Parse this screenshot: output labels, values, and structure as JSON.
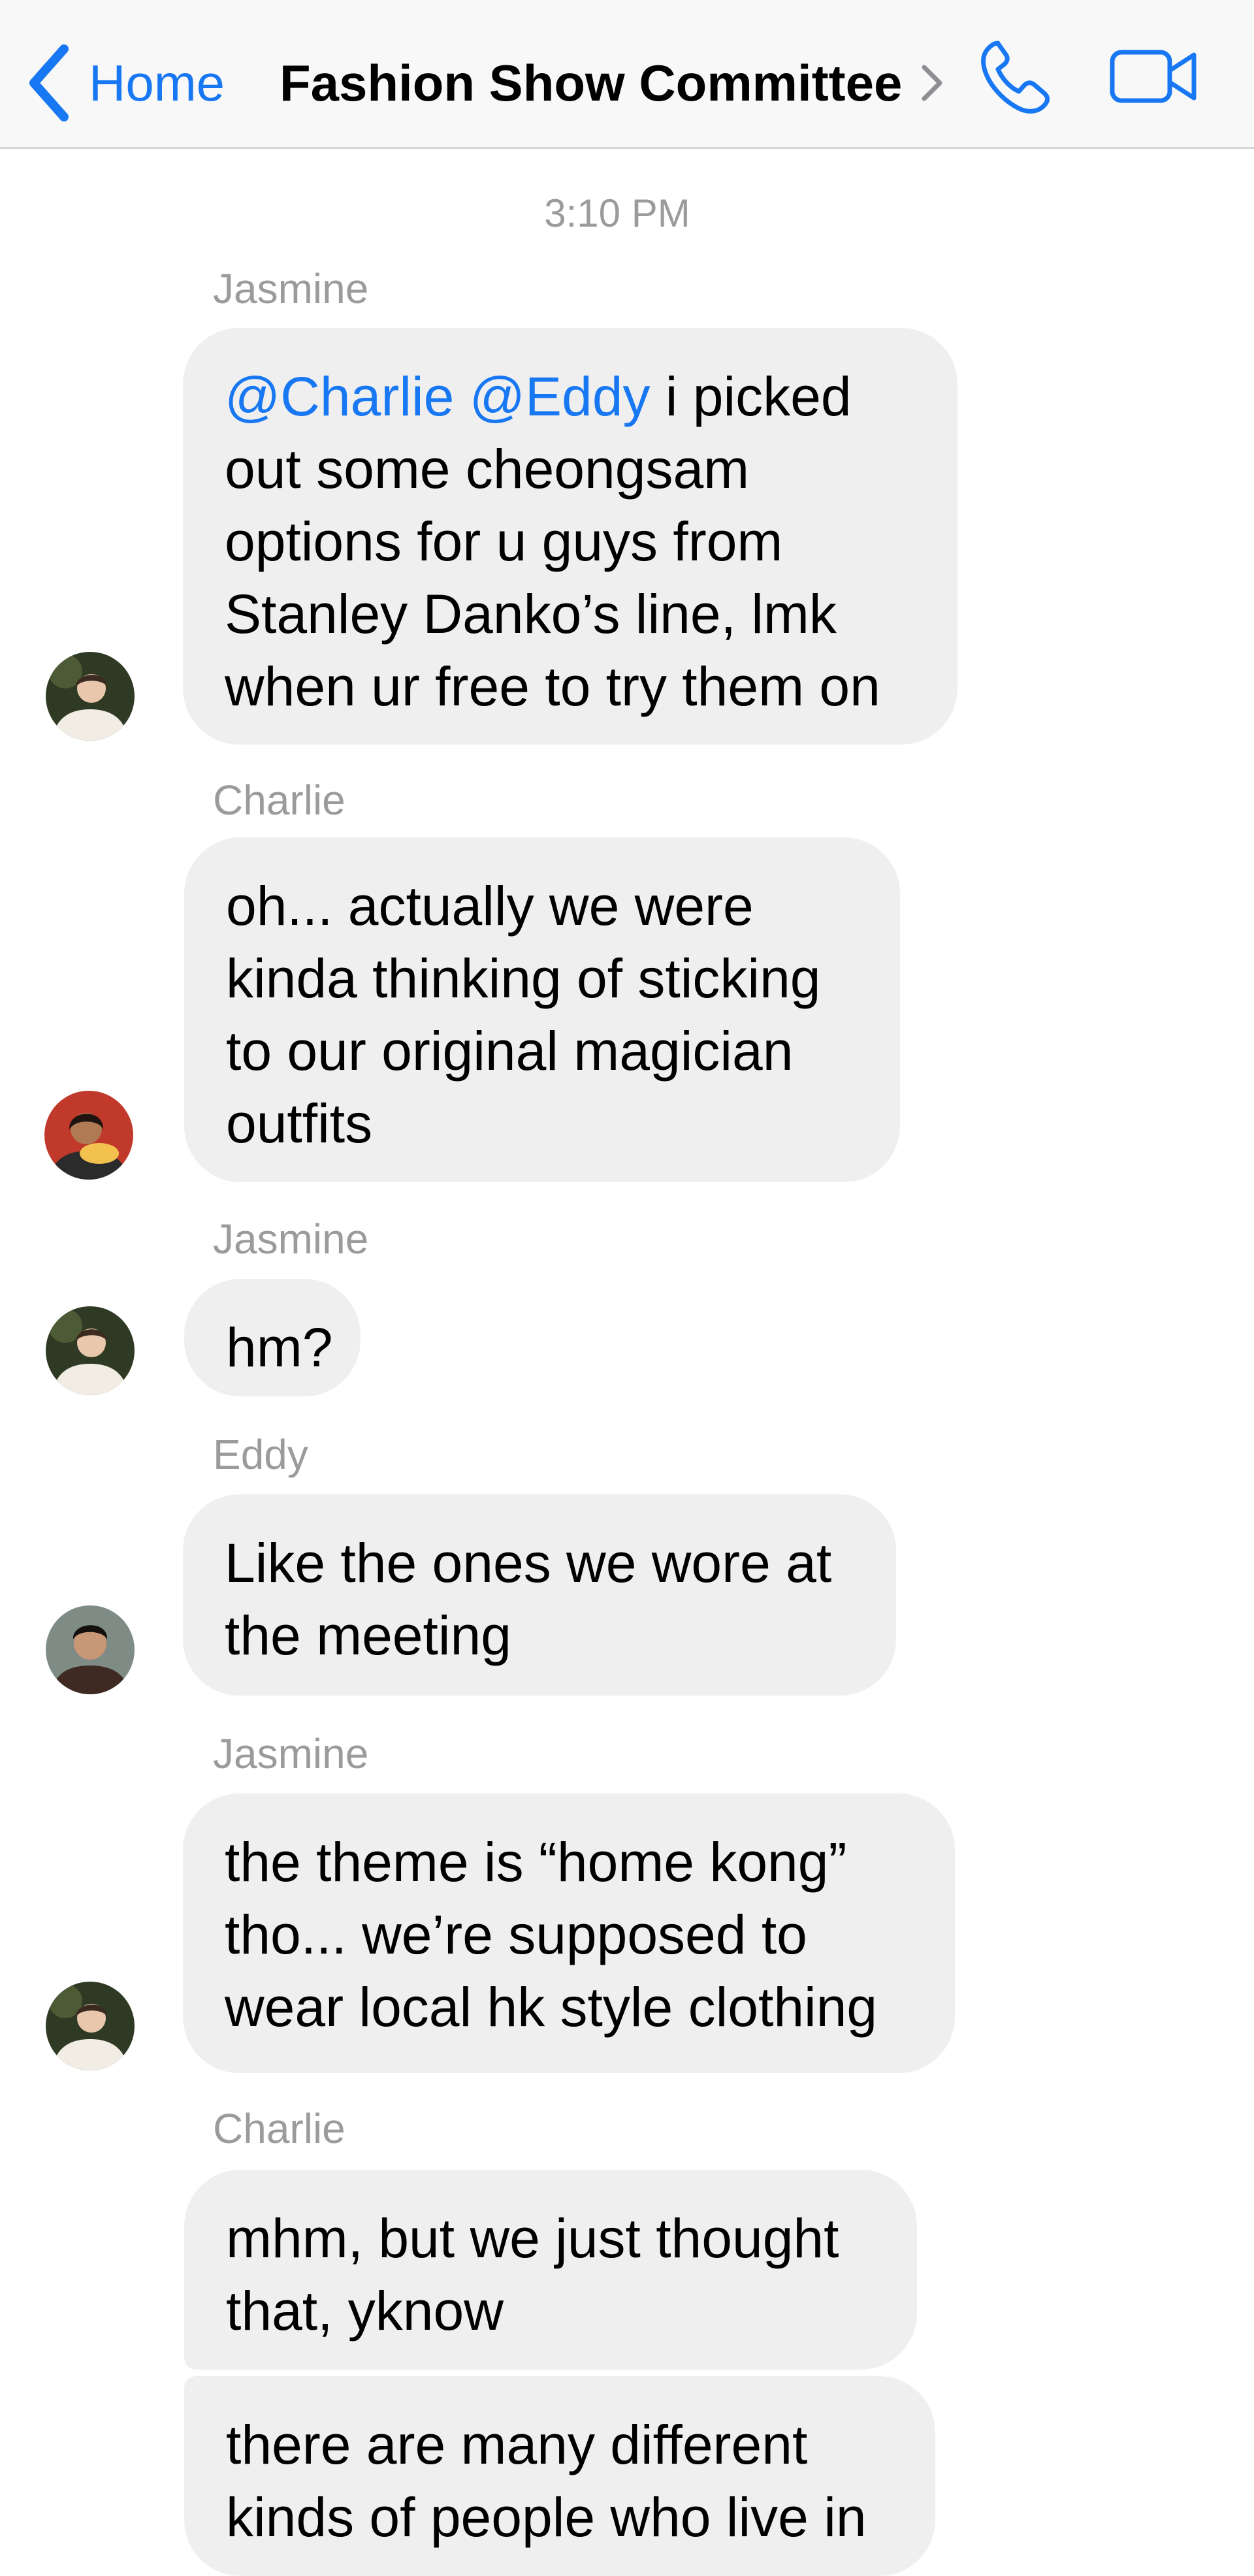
{
  "header": {
    "back_label": "Home",
    "title": "Fashion Show Committee"
  },
  "icons": {
    "back": "chevron-left-icon",
    "title_chevron": "chevron-right-icon",
    "call": "phone-icon",
    "video": "video-camera-icon",
    "accent_color": "#1877f2"
  },
  "thread": {
    "timestamp": "3:10 PM",
    "groups": [
      {
        "sender": "Jasmine",
        "messages": [
          {
            "mentions": "@Charlie @Eddy",
            "line1_rest": " i picked",
            "lines": [
              "out some cheongsam",
              "options for u guys from",
              "Stanley Danko’s line, lmk",
              "when ur free to try them on"
            ]
          }
        ]
      },
      {
        "sender": "Charlie",
        "messages": [
          {
            "lines": [
              "oh... actually we were",
              "kinda thinking of sticking",
              "to our original magician",
              "outfits"
            ]
          }
        ]
      },
      {
        "sender": "Jasmine",
        "messages": [
          {
            "lines": [
              "hm?"
            ]
          }
        ]
      },
      {
        "sender": "Eddy",
        "messages": [
          {
            "lines": [
              "Like the ones we wore at",
              "the meeting"
            ]
          }
        ]
      },
      {
        "sender": "Jasmine",
        "messages": [
          {
            "lines": [
              "the theme is “home kong”",
              "tho... we’re supposed to",
              "wear local hk style clothing"
            ]
          }
        ]
      },
      {
        "sender": "Charlie",
        "messages": [
          {
            "lines": [
              "mhm, but we just thought",
              "that, yknow"
            ]
          },
          {
            "lines": [
              "there are many different",
              "kinds of people who live in"
            ]
          }
        ]
      }
    ]
  }
}
